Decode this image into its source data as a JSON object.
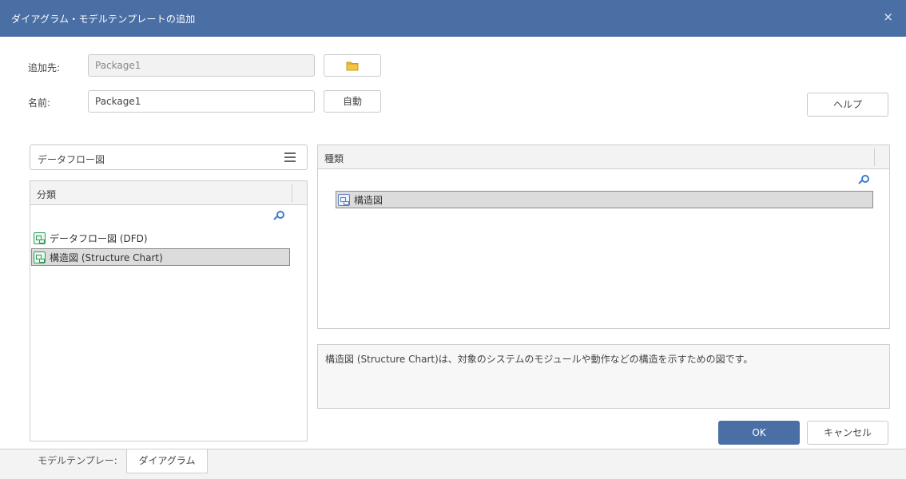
{
  "window": {
    "title": "ダイアグラム・モデルテンプレートの追加",
    "close_glyph": "×"
  },
  "form": {
    "destination_label": "追加先:",
    "destination_value": "Package1",
    "name_label": "名前:",
    "name_value": "Package1",
    "auto_button": "自動",
    "help_button": "ヘルプ",
    "browse_icon": "folder-icon"
  },
  "filter": {
    "selected": "データフロー図",
    "menu_icon": "hamburger-menu-icon"
  },
  "category_panel": {
    "header": "分類",
    "items": [
      {
        "label": "データフロー図 (DFD)",
        "selected": false
      },
      {
        "label": "構造図 (Structure Chart)",
        "selected": true
      }
    ]
  },
  "type_panel": {
    "header": "種類",
    "items": [
      {
        "label": "構造図",
        "selected": true
      }
    ]
  },
  "description": "構造図 (Structure Chart)は、対象のシステムのモジュールや動作などの構造を示すための図です。",
  "buttons": {
    "ok": "OK",
    "cancel": "キャンセル"
  },
  "tabs": [
    {
      "label": "モデルテンプレー:",
      "active": false
    },
    {
      "label": "ダイアグラム",
      "active": true
    }
  ],
  "colors": {
    "accent": "#4a6fa5",
    "selection_bg": "#dcdcdc"
  }
}
